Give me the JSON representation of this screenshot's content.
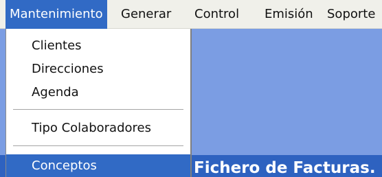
{
  "menubar": {
    "items": [
      {
        "label": "Mantenimiento"
      },
      {
        "label": "Generar"
      },
      {
        "label": "Control"
      },
      {
        "label": "Emisión"
      },
      {
        "label": "Soporte"
      }
    ]
  },
  "dropdown": {
    "items": [
      {
        "label": "Clientes"
      },
      {
        "label": "Direcciones"
      },
      {
        "label": "Agenda"
      },
      {
        "label": "Tipo Colaboradores"
      },
      {
        "label": "Conceptos"
      }
    ]
  },
  "workspace": {
    "window_title": "Fichero de Facturas. D"
  },
  "colors": {
    "menu_highlight": "#316ac5",
    "desktop_blue": "#7b9de3",
    "title_blue": "#2e62c0"
  }
}
